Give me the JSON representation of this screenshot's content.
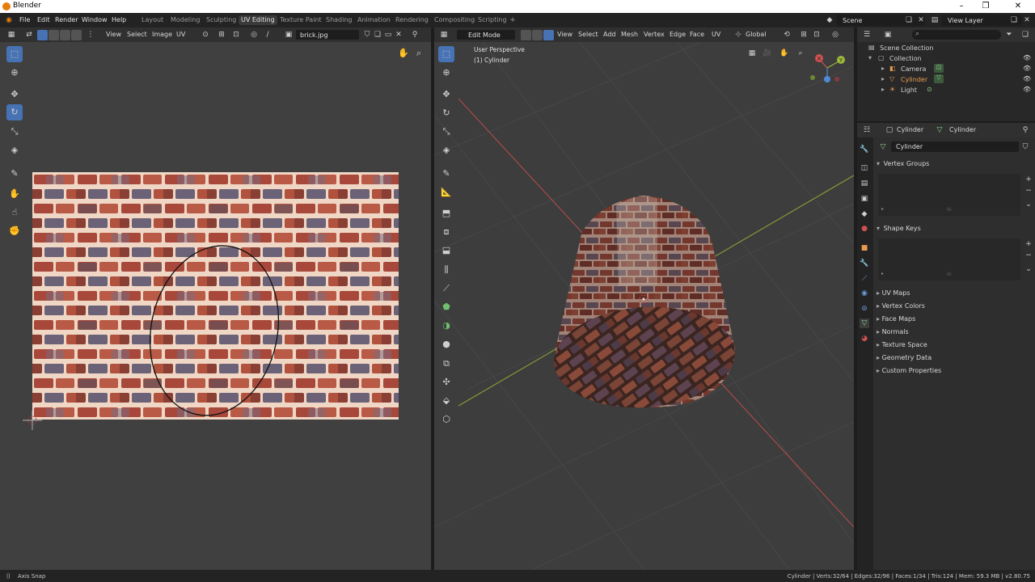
{
  "app": {
    "title": "Blender"
  },
  "menu": {
    "items": [
      "File",
      "Edit",
      "Render",
      "Window",
      "Help"
    ],
    "workspaces": [
      "Layout",
      "Modeling",
      "Sculpting",
      "UV Editing",
      "Texture Paint",
      "Shading",
      "Animation",
      "Rendering",
      "Compositing",
      "Scripting"
    ],
    "active_workspace": "UV Editing",
    "scene_label": "Scene",
    "view_layer_label": "View Layer"
  },
  "uv_editor": {
    "menus": [
      "View",
      "Select",
      "Image",
      "UV"
    ],
    "image_name": "brick.jpg"
  },
  "viewport": {
    "mode": "Edit Mode",
    "menus": [
      "View",
      "Select",
      "Add",
      "Mesh",
      "Vertex",
      "Edge",
      "Face",
      "UV"
    ],
    "orientation": "Global",
    "overlay_title": "User Perspective",
    "overlay_object": "(1) Cylinder",
    "gizmo_axes": [
      "X",
      "Y",
      "Z"
    ]
  },
  "outliner": {
    "root": "Scene Collection",
    "collection": "Collection",
    "items": [
      "Camera",
      "Cylinder",
      "Light"
    ],
    "selected_item": "Cylinder"
  },
  "properties": {
    "object_name": "Cylinder",
    "data_name": "Cylinder",
    "mesh_field": "Cylinder",
    "panels_open": [
      "Vertex Groups",
      "Shape Keys"
    ],
    "panels_closed": [
      "UV Maps",
      "Vertex Colors",
      "Face Maps",
      "Normals",
      "Texture Space",
      "Geometry Data",
      "Custom Properties"
    ]
  },
  "status": {
    "left": "Axis Snap",
    "right": "Cylinder | Verts:32/64 | Edges:32/96 | Faces:1/34 | Tris:124 | Mem: 59.3 MB | v2.80.75"
  },
  "colors": {
    "accent": "#4772b3",
    "x_axis": "#d05050",
    "y_axis": "#9ab83a",
    "selected_orange": "#e8a050"
  }
}
